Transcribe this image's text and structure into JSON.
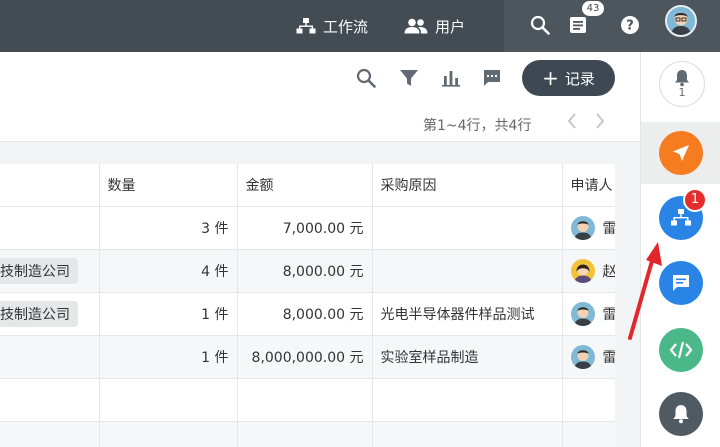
{
  "topbar": {
    "workflow_label": "工作流",
    "users_label": "用户",
    "inbox_badge": "43",
    "icons": [
      "workflow-icon",
      "users-icon",
      "search-icon",
      "inbox-icon",
      "help-icon",
      "avatar"
    ]
  },
  "toolbar": {
    "add_record_label": "记录",
    "pagination_text": "第1~4行，共4行",
    "icons": [
      "search-icon",
      "filter-icon",
      "chart-icon",
      "comment-icon"
    ]
  },
  "table": {
    "columns": [
      "数量",
      "金额",
      "采购原因",
      "申请人"
    ],
    "rows": [
      {
        "company": "",
        "qty": "3 件",
        "amount": "7,000.00 元",
        "reason": "",
        "applicant": "雷"
      },
      {
        "company": "技制造公司",
        "qty": "4 件",
        "amount": "8,000.00 元",
        "reason": "",
        "applicant": "赵"
      },
      {
        "company": "技制造公司",
        "qty": "1 件",
        "amount": "8,000.00 元",
        "reason": "光电半导体器件样品测试",
        "applicant": "雷"
      },
      {
        "company": "",
        "qty": "1 件",
        "amount": "8,000,000.00 元",
        "reason": "实验室样品制造",
        "applicant": "雷"
      }
    ]
  },
  "rightbar": {
    "bell_count": "1",
    "workflow_badge": "1",
    "colors": {
      "send": "#f57c1f",
      "workflow": "#2a84e5",
      "chat": "#2a84e5",
      "code": "#4bb88a",
      "notify": "#4f5a63"
    }
  }
}
